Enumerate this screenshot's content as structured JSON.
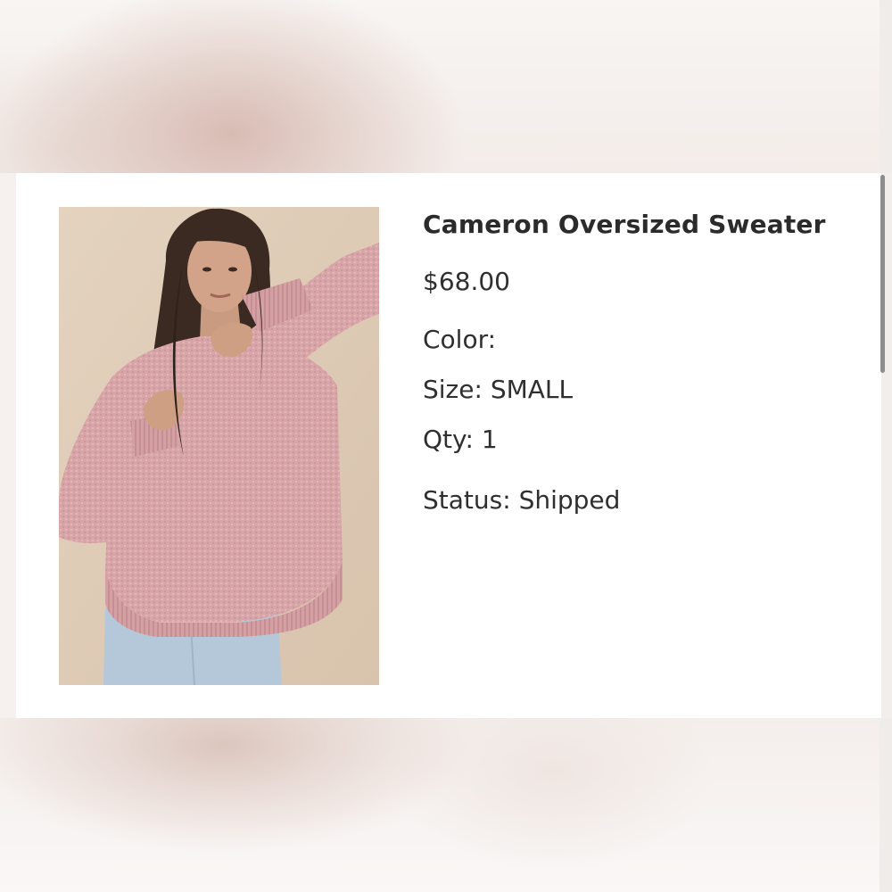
{
  "product": {
    "name": "Cameron Oversized Sweater",
    "price": "$68.00",
    "color_label": "Color:",
    "color_value": "",
    "size_label": "Size:",
    "size_value": "SMALL",
    "qty_label": "Qty:",
    "qty_value": "1",
    "status_label": "Status:",
    "status_value": "Shipped",
    "image": {
      "subject": "model-wearing-pink-oversized-sweater",
      "sweater_color": "#d8a5a8",
      "background_color": "#dfccb6",
      "jeans_color": "#b4c8da"
    }
  },
  "theme": {
    "card_background": "#ffffff",
    "text_color": "#2f2f2f",
    "page_background": "#f6f1ef",
    "scrollbar_color": "#8d8d8d"
  }
}
